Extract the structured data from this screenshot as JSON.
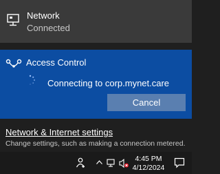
{
  "network": {
    "title": "Network",
    "status": "Connected",
    "icon": "wired-network-icon"
  },
  "vpn": {
    "title": "Access Control",
    "icon": "vpn-icon",
    "status": "Connecting to corp.mynet.care",
    "cancel_label": "Cancel",
    "panel_color": "#0c4da2"
  },
  "settings": {
    "link_label": "Network & Internet settings",
    "description": "Change settings, such as making a connection metered."
  },
  "taskbar": {
    "time": "4:45 PM",
    "date": "4/12/2024",
    "icons": [
      "people-icon",
      "chevron-up-icon",
      "network-icon",
      "volume-muted-icon",
      "notification-icon"
    ]
  }
}
